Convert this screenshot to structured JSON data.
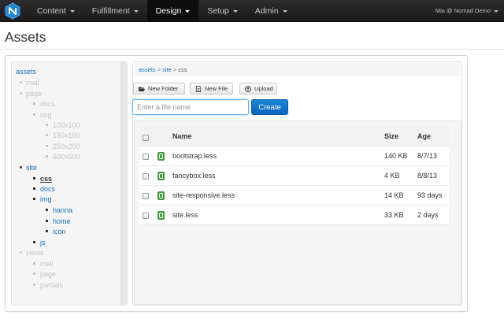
{
  "nav": {
    "items": [
      {
        "label": "Content",
        "active": false
      },
      {
        "label": "Fulfillment",
        "active": false
      },
      {
        "label": "Design",
        "active": true
      },
      {
        "label": "Setup",
        "active": false
      },
      {
        "label": "Admin",
        "active": false
      }
    ],
    "user": "Mia @ Nomad Demo"
  },
  "page": {
    "title": "Assets"
  },
  "tree": {
    "root": "assets",
    "mail": "mail",
    "page": "page",
    "docs": "docs",
    "img": "img",
    "img_100": "100x100",
    "img_150": "150x150",
    "img_250": "250x250",
    "img_600": "600x600",
    "site": "site",
    "site_css": "css",
    "site_docs": "docs",
    "site_img": "img",
    "hanna": "hanna",
    "home": "home",
    "icon": "icon",
    "js": "js",
    "views": "views",
    "views_mail": "mail",
    "views_page": "page",
    "partials": "partials"
  },
  "breadcrumb": {
    "a": "assets",
    "b": "site",
    "c": "css",
    "sep": ">"
  },
  "toolbar": {
    "new_folder": "New Folder",
    "new_file": "New File",
    "upload": "Upload"
  },
  "create": {
    "placeholder": "Enter a file name",
    "button": "Create"
  },
  "table": {
    "headers": {
      "name": "Name",
      "size": "Size",
      "age": "Age"
    },
    "rows": [
      {
        "name": "bootstrap.less",
        "size": "140 KB",
        "age": "8/7/13"
      },
      {
        "name": "fancybox.less",
        "size": "4 KB",
        "age": "8/8/13"
      },
      {
        "name": "site-responsive.less",
        "size": "14 KB",
        "age": "93 days"
      },
      {
        "name": "site.less",
        "size": "33 KB",
        "age": "2 days"
      }
    ]
  },
  "colors": {
    "link": "#0f73c5",
    "primary": "#0b63c0",
    "file_icon": "#3f9e3f",
    "nav_bg": "#1b1b1b"
  }
}
